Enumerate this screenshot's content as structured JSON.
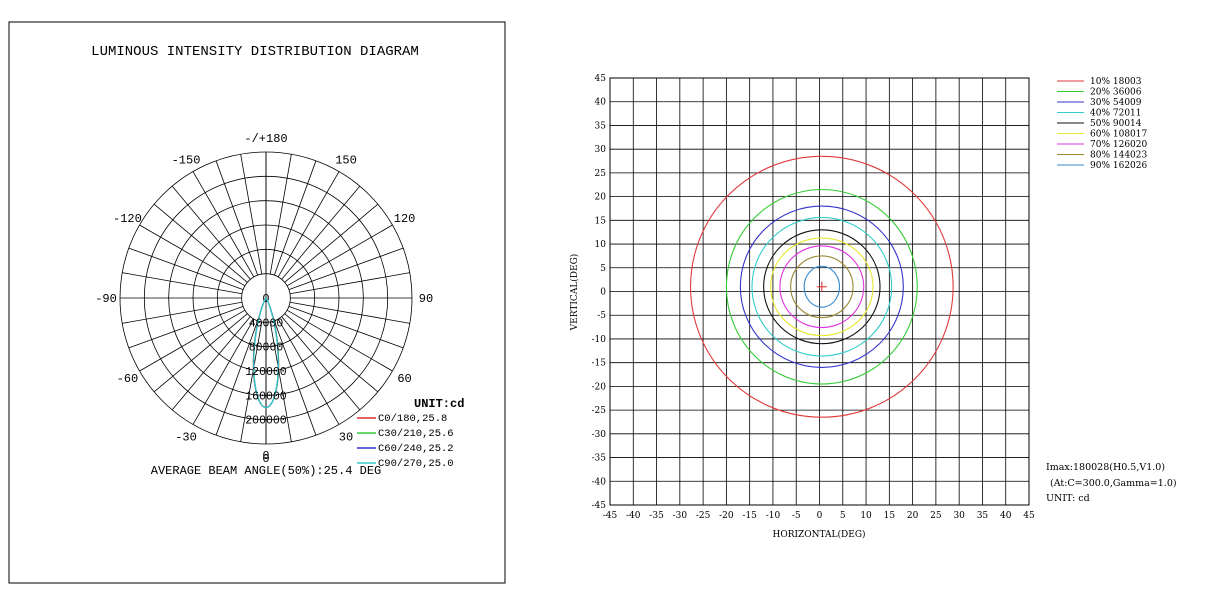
{
  "chart_data": [
    {
      "type": "polar",
      "title": "LUMINOUS INTENSITY DISTRIBUTION DIAGRAM",
      "angle_labels": [
        "-/+180",
        "150",
        "120",
        "90",
        "60",
        "30",
        "0",
        "-30",
        "-60",
        "-90",
        "-120",
        "-150"
      ],
      "angle_values": [
        180,
        150,
        120,
        90,
        60,
        30,
        0,
        -30,
        -60,
        -90,
        -120,
        -150
      ],
      "radial_ticks": [
        0,
        40000,
        80000,
        120000,
        160000,
        200000
      ],
      "rmax": 240000,
      "unit_label": "UNIT:cd",
      "series": [
        {
          "name": "C0/180,25.8",
          "color": "#d93030",
          "beam_angle": 25.8,
          "peak": 180028
        },
        {
          "name": "C30/210,25.6",
          "color": "#33cc33",
          "beam_angle": 25.6,
          "peak": 180028
        },
        {
          "name": "C60/240,25.2",
          "color": "#3333cc",
          "beam_angle": 25.2,
          "peak": 180028
        },
        {
          "name": "C90/270,25.0",
          "color": "#33cccc",
          "beam_angle": 25.0,
          "peak": 180028
        }
      ],
      "footer": "AVERAGE BEAM ANGLE(50%):25.4 DEG"
    },
    {
      "type": "contour",
      "xlabel": "HORIZONTAL(DEG)",
      "ylabel": "VERTICAL(DEG)",
      "xlim": [
        -45,
        45
      ],
      "ylim": [
        -45,
        45
      ],
      "tick_step": 5,
      "grid": true,
      "center": [
        0.5,
        1.0
      ],
      "series": [
        {
          "name": "10% 18003",
          "color": "#e03a3a",
          "rx": 28.2,
          "ry": 27.5
        },
        {
          "name": "20% 36006",
          "color": "#33cc33",
          "rx": 20.5,
          "ry": 20.5
        },
        {
          "name": "30% 54009",
          "color": "#3333cc",
          "rx": 17.5,
          "ry": 17.0
        },
        {
          "name": "40% 72011",
          "color": "#33cccc",
          "rx": 15.0,
          "ry": 14.6
        },
        {
          "name": "50% 90014",
          "color": "#111111",
          "rx": 12.5,
          "ry": 12.0
        },
        {
          "name": "60% 108017",
          "color": "#e8e833",
          "rx": 11.0,
          "ry": 10.3
        },
        {
          "name": "70% 126020",
          "color": "#dd33dd",
          "rx": 9.0,
          "ry": 8.6
        },
        {
          "name": "80% 144023",
          "color": "#998833",
          "rx": 6.7,
          "ry": 6.5
        },
        {
          "name": "90% 162026",
          "color": "#3388cc",
          "rx": 3.8,
          "ry": 4.3
        }
      ],
      "info": [
        "Imax:180028(H0.5,V1.0)",
        "(At:C=300.0,Gamma=1.0)",
        "UNIT: cd"
      ]
    }
  ]
}
